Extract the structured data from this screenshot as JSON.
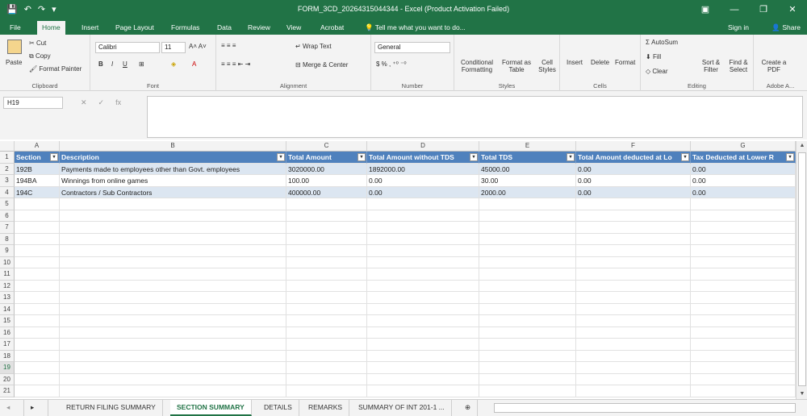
{
  "window": {
    "title": "FORM_3CD_20264315044344 - Excel (Product Activation Failed)",
    "signin": "Sign in",
    "share": "Share"
  },
  "tabs": [
    "File",
    "Home",
    "Insert",
    "Page Layout",
    "Formulas",
    "Data",
    "Review",
    "View",
    "Acrobat"
  ],
  "tell_me": "Tell me what you want to do...",
  "ribbon": {
    "clipboard": {
      "paste": "Paste",
      "cut": "Cut",
      "copy": "Copy",
      "format_painter": "Format Painter",
      "label": "Clipboard"
    },
    "font": {
      "name": "Calibri",
      "size": "11",
      "label": "Font"
    },
    "alignment": {
      "wrap": "Wrap Text",
      "merge": "Merge & Center",
      "label": "Alignment"
    },
    "number": {
      "format": "General",
      "label": "Number"
    },
    "styles": {
      "cond": "Conditional Formatting",
      "table": "Format as Table",
      "cell": "Cell Styles",
      "label": "Styles"
    },
    "cells": {
      "insert": "Insert",
      "delete": "Delete",
      "format": "Format",
      "label": "Cells"
    },
    "editing": {
      "autosum": "AutoSum",
      "fill": "Fill",
      "clear": "Clear",
      "sort": "Sort & Filter",
      "find": "Find & Select",
      "label": "Editing"
    },
    "adobe": {
      "create": "Create a PDF",
      "label": "Adobe A..."
    }
  },
  "namebox": "H19",
  "columns": [
    "A",
    "B",
    "C",
    "D",
    "E",
    "F",
    "G"
  ],
  "header": [
    "Section",
    "Description",
    "Total Amount",
    "Total Amount without TDS",
    "Total TDS",
    "Total Amount deducted at Lo",
    "Tax Deducted at Lower R"
  ],
  "rows": [
    [
      "192B",
      "Payments made to employees other than Govt. employees",
      "3020000.00",
      "1892000.00",
      "45000.00",
      "0.00",
      "0.00"
    ],
    [
      "194BA",
      "Winnings from online games",
      "100.00",
      "0.00",
      "30.00",
      "0.00",
      "0.00"
    ],
    [
      "194C",
      "Contractors / Sub Contractors",
      "400000.00",
      "0.00",
      "2000.00",
      "0.00",
      "0.00"
    ]
  ],
  "row_numbers": [
    "1",
    "2",
    "3",
    "4",
    "5",
    "6",
    "7",
    "8",
    "9",
    "10",
    "11",
    "12",
    "13",
    "14",
    "15",
    "16",
    "17",
    "18",
    "19",
    "20",
    "21"
  ],
  "sheets": [
    "RETURN FILING SUMMARY",
    "SECTION SUMMARY",
    "DETAILS",
    "REMARKS",
    "SUMMARY OF INT 201-1 ..."
  ],
  "active_sheet": "SECTION SUMMARY"
}
